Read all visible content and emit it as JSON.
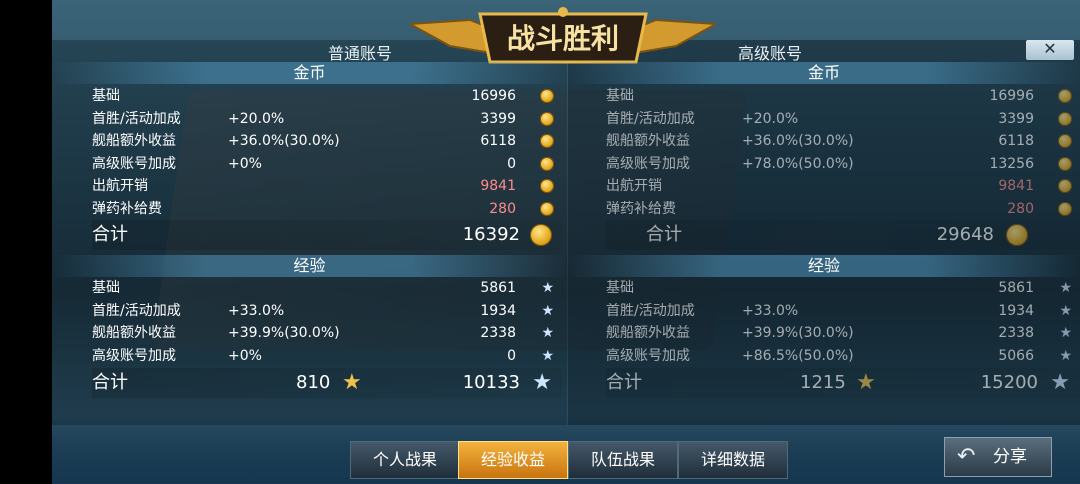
{
  "title": "战斗胜利",
  "close_label": "✕",
  "tabs": {
    "normal": "普通账号",
    "premium": "高级账号"
  },
  "sections": {
    "gold": "金币",
    "exp": "经验"
  },
  "normal": {
    "gold_rows": [
      {
        "label": "基础",
        "bonus": "",
        "value": "16996"
      },
      {
        "label": "首胜/活动加成",
        "bonus": "+20.0%",
        "value": "3399"
      },
      {
        "label": "舰船额外收益",
        "bonus": "+36.0%(30.0%)",
        "value": "6118"
      },
      {
        "label": "高级账号加成",
        "bonus": "+0%",
        "value": "0"
      },
      {
        "label": "出航开销",
        "bonus": "",
        "value": "9841"
      },
      {
        "label": "弹药补给费",
        "bonus": "",
        "value": "280"
      }
    ],
    "gold_total": {
      "label": "合计",
      "value": "16392"
    },
    "exp_rows": [
      {
        "label": "基础",
        "bonus": "",
        "value": "5861"
      },
      {
        "label": "首胜/活动加成",
        "bonus": "+33.0%",
        "value": "1934"
      },
      {
        "label": "舰船额外收益",
        "bonus": "+39.9%(30.0%)",
        "value": "2338"
      },
      {
        "label": "高级账号加成",
        "bonus": "+0%",
        "value": "0"
      }
    ],
    "exp_total": {
      "label": "合计",
      "free": "810",
      "value": "10133"
    }
  },
  "premium": {
    "gold_rows": [
      {
        "label": "基础",
        "bonus": "",
        "value": "16996"
      },
      {
        "label": "首胜/活动加成",
        "bonus": "+20.0%",
        "value": "3399"
      },
      {
        "label": "舰船额外收益",
        "bonus": "+36.0%(30.0%)",
        "value": "6118"
      },
      {
        "label": "高级账号加成",
        "bonus": "+78.0%(50.0%)",
        "value": "13256"
      },
      {
        "label": "出航开销",
        "bonus": "",
        "value": "9841"
      },
      {
        "label": "弹药补给费",
        "bonus": "",
        "value": "280"
      }
    ],
    "gold_total": {
      "label": "合计",
      "value": "29648"
    },
    "exp_rows": [
      {
        "label": "基础",
        "bonus": "",
        "value": "5861"
      },
      {
        "label": "首胜/活动加成",
        "bonus": "+33.0%",
        "value": "1934"
      },
      {
        "label": "舰船额外收益",
        "bonus": "+39.9%(30.0%)",
        "value": "2338"
      },
      {
        "label": "高级账号加成",
        "bonus": "+86.5%(50.0%)",
        "value": "5066"
      }
    ],
    "exp_total": {
      "label": "合计",
      "free": "1215",
      "value": "15200"
    }
  },
  "buttons": [
    "个人战果",
    "经验收益",
    "队伍战果",
    "详细数据"
  ],
  "active_button": 1,
  "share_label": "分享",
  "icons": {
    "gold": "coin-icon",
    "exp": "star-icon",
    "free_exp": "gold-star-icon",
    "share": "share-arrow-icon"
  },
  "colors": {
    "cost": "#ff8a8a",
    "active_tab": "#e8a126"
  }
}
